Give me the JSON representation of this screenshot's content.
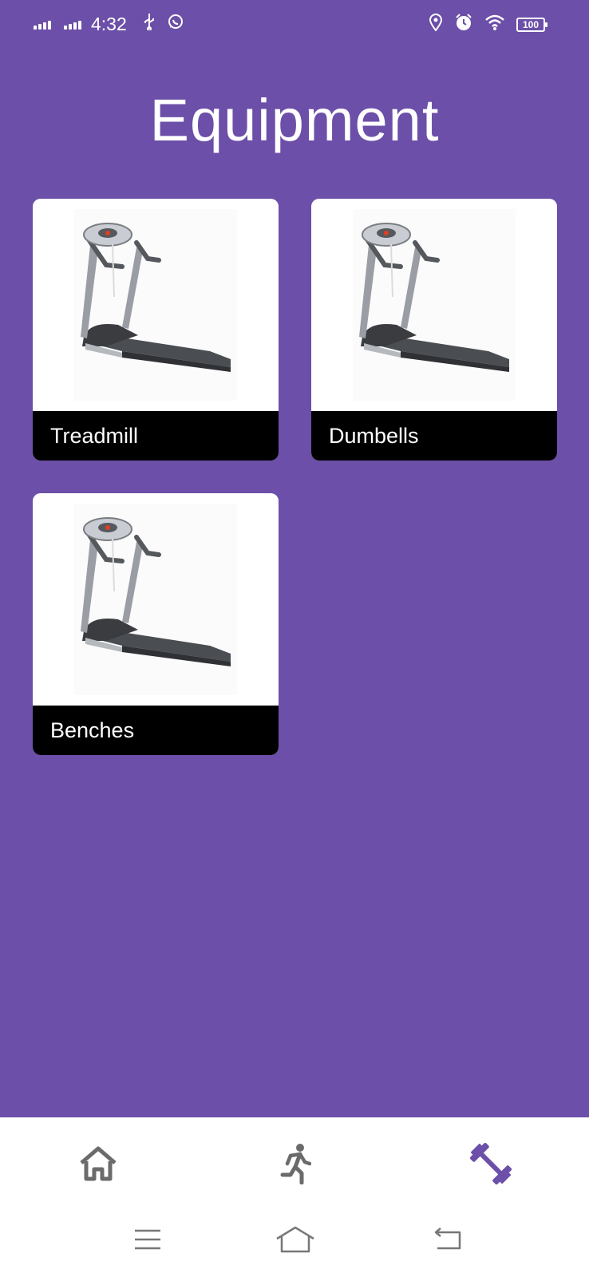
{
  "status_bar": {
    "time": "4:32",
    "battery": "100",
    "icons": [
      "signal-icon",
      "signal-icon",
      "usb-icon",
      "whatsapp-icon",
      "location-icon",
      "alarm-icon",
      "wifi-icon",
      "battery-icon"
    ]
  },
  "title": "Equipment",
  "cards": [
    {
      "label": "Treadmill",
      "image": "treadmill-image"
    },
    {
      "label": "Dumbells",
      "image": "treadmill-image"
    },
    {
      "label": "Benches",
      "image": "treadmill-image"
    }
  ],
  "bottom_nav": {
    "items": [
      {
        "icon": "home-icon",
        "active": false
      },
      {
        "icon": "running-person-icon",
        "active": false
      },
      {
        "icon": "dumbbell-icon",
        "active": true
      }
    ]
  },
  "colors": {
    "background": "#6c4fa8",
    "card_label_bg": "#000000",
    "nav_active": "#6c4fa8",
    "nav_inactive": "#6b6b6b"
  }
}
